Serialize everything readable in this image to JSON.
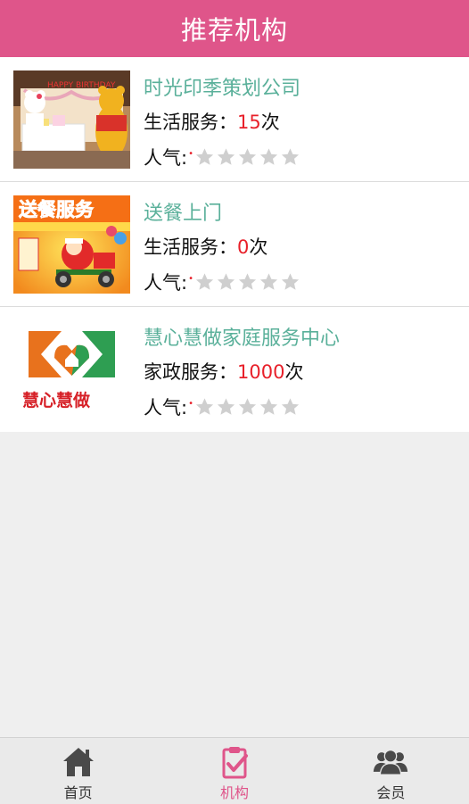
{
  "header": {
    "title": "推荐机构"
  },
  "orgs": [
    {
      "name": "时光印季策划公司",
      "service_label": "生活服务：",
      "count": "15",
      "unit": "次",
      "pop_label": "人气:",
      "rating": 0,
      "thumb": "party-decor-photo"
    },
    {
      "name": "送餐上门",
      "service_label": "生活服务：",
      "count": "0",
      "unit": "次",
      "pop_label": "人气:",
      "rating": 0,
      "thumb": "delivery-poster",
      "thumb_text": "送餐服务"
    },
    {
      "name": "慧心慧做家庭服务中心",
      "service_label": "家政服务：",
      "count": "1000",
      "unit": "次",
      "pop_label": "人气:",
      "rating": 0,
      "thumb": "huixin-logo",
      "thumb_text": "慧心慧做"
    }
  ],
  "tabs": [
    {
      "label": "首页",
      "icon": "home-icon",
      "active": false
    },
    {
      "label": "机构",
      "icon": "clipboard-check-icon",
      "active": true
    },
    {
      "label": "会员",
      "icon": "members-icon",
      "active": false
    }
  ],
  "colors": {
    "brand": "#df558a",
    "name": "#5ab09a",
    "count": "#e8202a",
    "star_empty": "#cfcfcf"
  }
}
